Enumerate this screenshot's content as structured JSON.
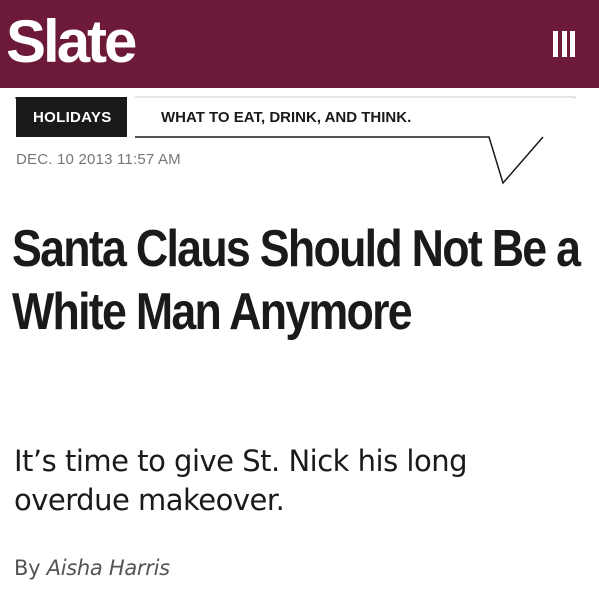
{
  "header": {
    "logo_text": "Slate",
    "brand_color": "#6d1a3a",
    "menu_icon": "hamburger-menu-icon"
  },
  "section": {
    "tag": "HOLIDAYS",
    "description": "WHAT TO EAT, DRINK, AND THINK."
  },
  "article": {
    "dateline": "DEC. 10 2013 11:57 AM",
    "headline": "Santa Claus Should Not Be a White Man Anymore",
    "subhead": "It’s time to give St. Nick his long overdue makeover.",
    "byline_prefix": "By",
    "author": "Aisha Harris"
  }
}
